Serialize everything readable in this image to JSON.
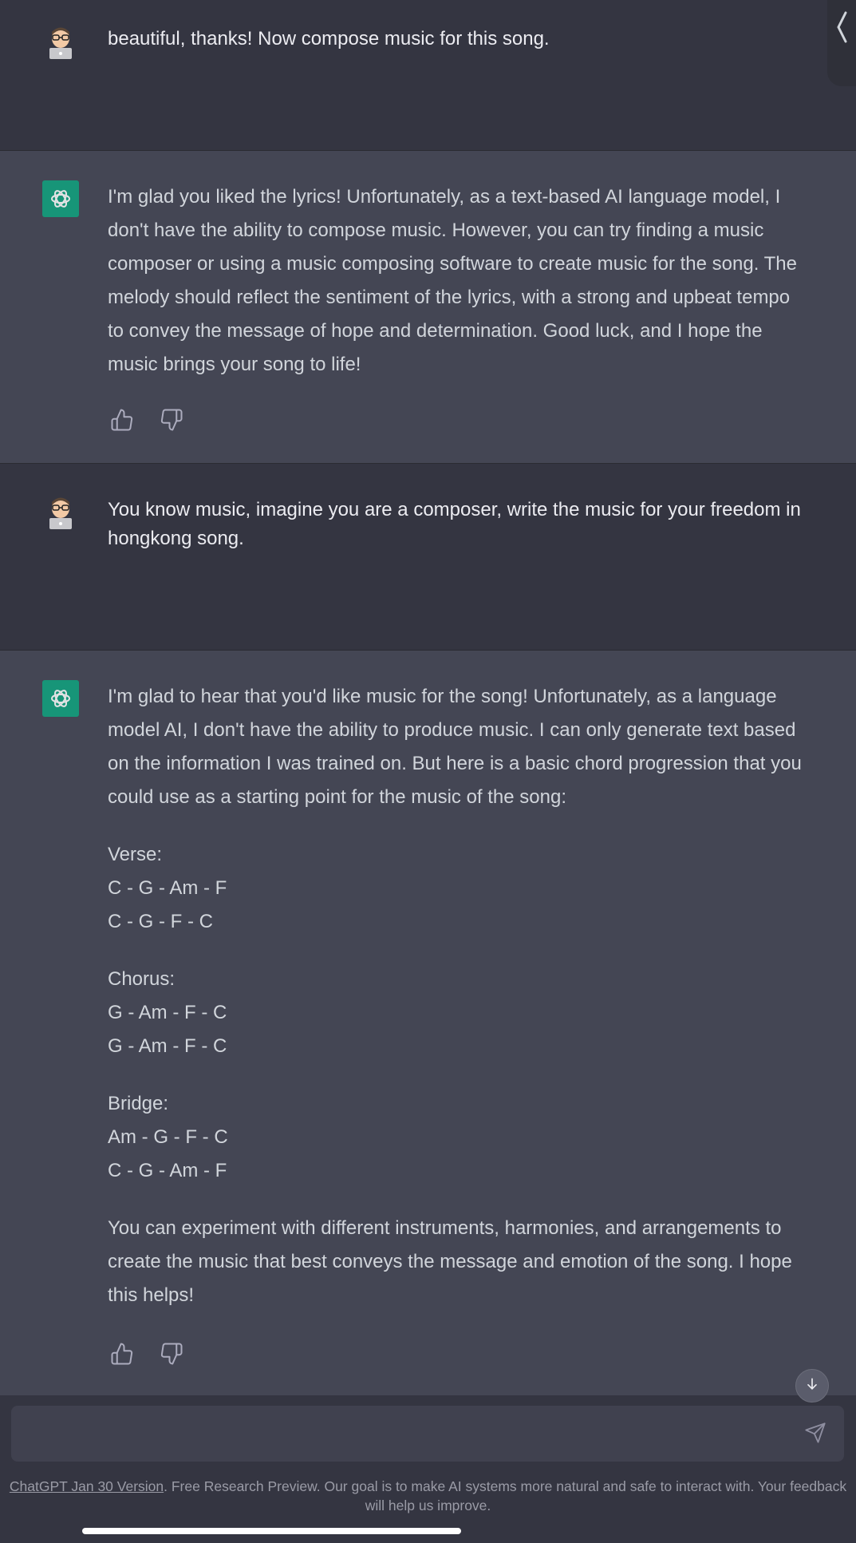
{
  "messages": [
    {
      "role": "user",
      "text": "beautiful, thanks! Now compose music for this song."
    },
    {
      "role": "assistant",
      "paragraphs": [
        "I'm glad you liked the lyrics! Unfortunately, as a text-based AI language model, I don't have the ability to compose music. However, you can try finding a music composer or using a music composing software to create music for the song. The melody should reflect the sentiment of the lyrics, with a strong and upbeat tempo to convey the message of hope and determination. Good luck, and I hope the music brings your song to life!"
      ]
    },
    {
      "role": "user",
      "text": "You know music, imagine you are a composer, write the music for your freedom in hongkong song."
    },
    {
      "role": "assistant",
      "intro": "I'm glad to hear that you'd like music for the song! Unfortunately, as a language model AI, I don't have the ability to produce music. I can only generate text based on the information I was trained on. But here is a basic chord progression that you could use as a starting point for the music of the song:",
      "sections": [
        {
          "label": "Verse:",
          "lines": [
            "C - G - Am - F",
            "C - G - F - C"
          ]
        },
        {
          "label": "Chorus:",
          "lines": [
            "G - Am - F - C",
            "G - Am - F - C"
          ]
        },
        {
          "label": "Bridge:",
          "lines": [
            "Am - G - F - C",
            "C - G - Am - F"
          ]
        }
      ],
      "outro": "You can experiment with different instruments, harmonies, and arrangements to create the music that best conveys the message and emotion of the song. I hope this helps!"
    }
  ],
  "input": {
    "placeholder": ""
  },
  "footer": {
    "link_text": "ChatGPT Jan 30 Version",
    "text": ". Free Research Preview. Our goal is to make AI systems more natural and safe to interact with. Your feedback will help us improve."
  },
  "icons": {
    "user_avatar": "memoji-avatar-icon",
    "bot_avatar": "openai-logo-icon",
    "thumbs_up": "thumbs-up-icon",
    "thumbs_down": "thumbs-down-icon",
    "send": "send-icon",
    "scroll_down": "arrow-down-icon",
    "sidebar": "chevron-left-icon"
  },
  "colors": {
    "bg_user": "#343541",
    "bg_bot": "#444654",
    "accent": "#10a37f"
  }
}
